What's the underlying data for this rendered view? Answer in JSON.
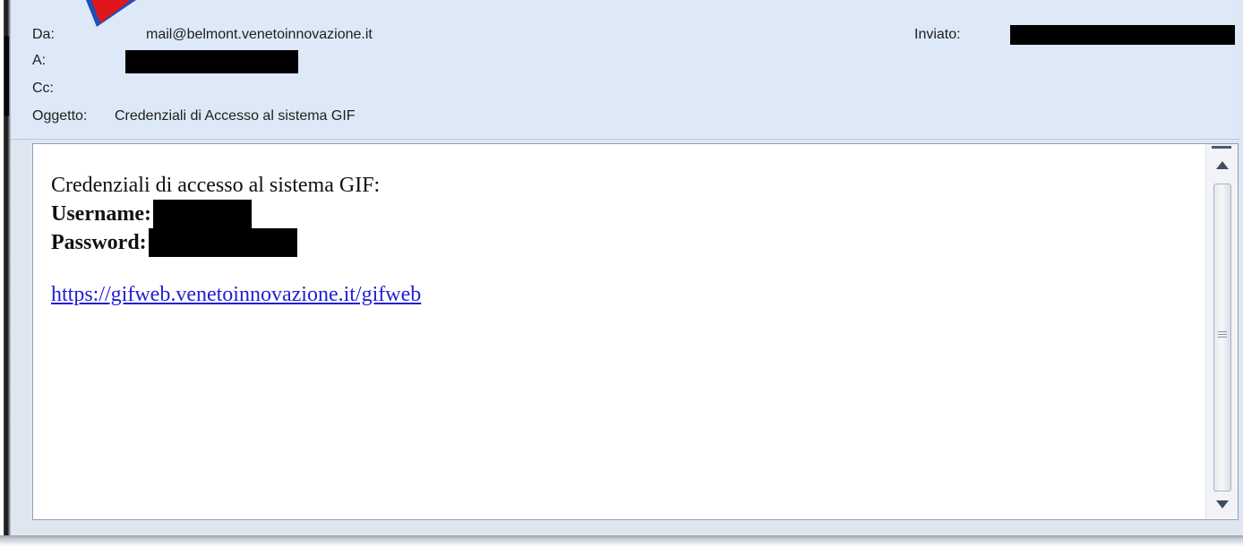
{
  "header": {
    "from_label": "Da:",
    "from_value": "mail@belmont.venetoinnovazione.it",
    "sent_label": "Inviato:",
    "to_label": "A:",
    "cc_label": "Cc:",
    "subject_label": "Oggetto:",
    "subject_value": "Credenziali di Accesso al sistema GIF"
  },
  "body": {
    "intro": "Credenziali di accesso al sistema GIF:",
    "username_label": "Username:",
    "password_label": "Password:",
    "link": "https://gifweb.venetoinnovazione.it/gifweb"
  },
  "icons": {
    "arrow": "red-pointer-arrow-icon",
    "scroll_up": "scroll-up-arrow-icon",
    "scroll_down": "scroll-down-arrow-icon",
    "scroll_grip": "scroll-grip-icon"
  },
  "colors": {
    "header_bg": "#dde9f7",
    "link": "#1f1fd6",
    "arrow_fill": "#e0161a",
    "arrow_outline": "#1d4fb8",
    "redaction": "#000000"
  }
}
